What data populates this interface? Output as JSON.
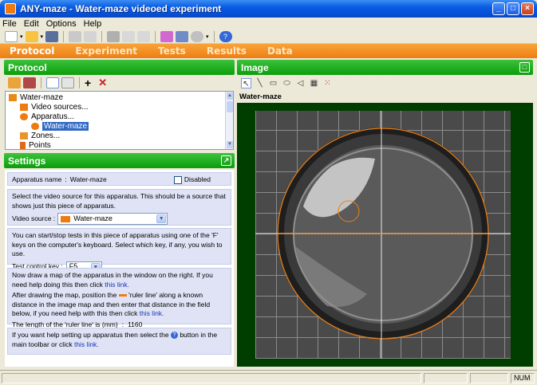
{
  "window": {
    "title": "ANY-maze - Water-maze videoed experiment"
  },
  "menu": [
    "File",
    "Edit",
    "Options",
    "Help"
  ],
  "nav": [
    "Protocol",
    "Experiment",
    "Tests",
    "Results",
    "Data"
  ],
  "panels": {
    "protocol": "Protocol",
    "settings": "Settings",
    "image": "Image"
  },
  "tree": [
    {
      "label": "Water-maze",
      "icon": "apparatus-icon"
    },
    {
      "label": "Video sources...",
      "icon": "camera-icon"
    },
    {
      "label": "Apparatus...",
      "icon": "target-icon"
    },
    {
      "label": "Water-maze",
      "icon": "target-icon"
    },
    {
      "label": "Zones...",
      "icon": "zone-icon"
    },
    {
      "label": "Points",
      "icon": "flag-icon"
    }
  ],
  "settings": {
    "apparatus_name_label": "Apparatus name",
    "apparatus_name_sep": ":",
    "apparatus_name_value": "Water-maze",
    "disabled_label": "Disabled",
    "video_text": "Select the video source for this apparatus. This should be a source that shows just this piece of apparatus.",
    "video_source_label": "Video source :",
    "video_source_value": "Water-maze",
    "keys_text": "You can start/stop tests in this piece of apparatus using one of the 'F' keys on the computer's keyboard. Select which key, if any, you wish to use.",
    "test_control_label": "Test control key :",
    "test_control_value": "F5",
    "map_text": "Now draw a map of the apparatus in the window on the right. If you need help doing this then click",
    "map_link": "this link.",
    "ruler_text_1": "After drawing the map, position the",
    "ruler_text_2": "'ruler line' along a known distance in the image map and then enter that distance in the field below, if you need help with this then click",
    "ruler_link": "this link.",
    "ruler_len_label": "The length of the 'ruler line' is (mm)",
    "ruler_len_sep": ":",
    "ruler_len_value": "1160",
    "help_text_1": "If you want help setting up apparatus then select the",
    "help_text_2": "button in the main toolbar or click",
    "help_link": "this link."
  },
  "image": {
    "label": "Water-maze"
  },
  "status": {
    "num": "NUM"
  },
  "colors": {
    "accent_orange": "#ee7e12",
    "panel_green": "#0a9d0a",
    "image_bg": "#003e00",
    "link": "#1a34b8"
  }
}
